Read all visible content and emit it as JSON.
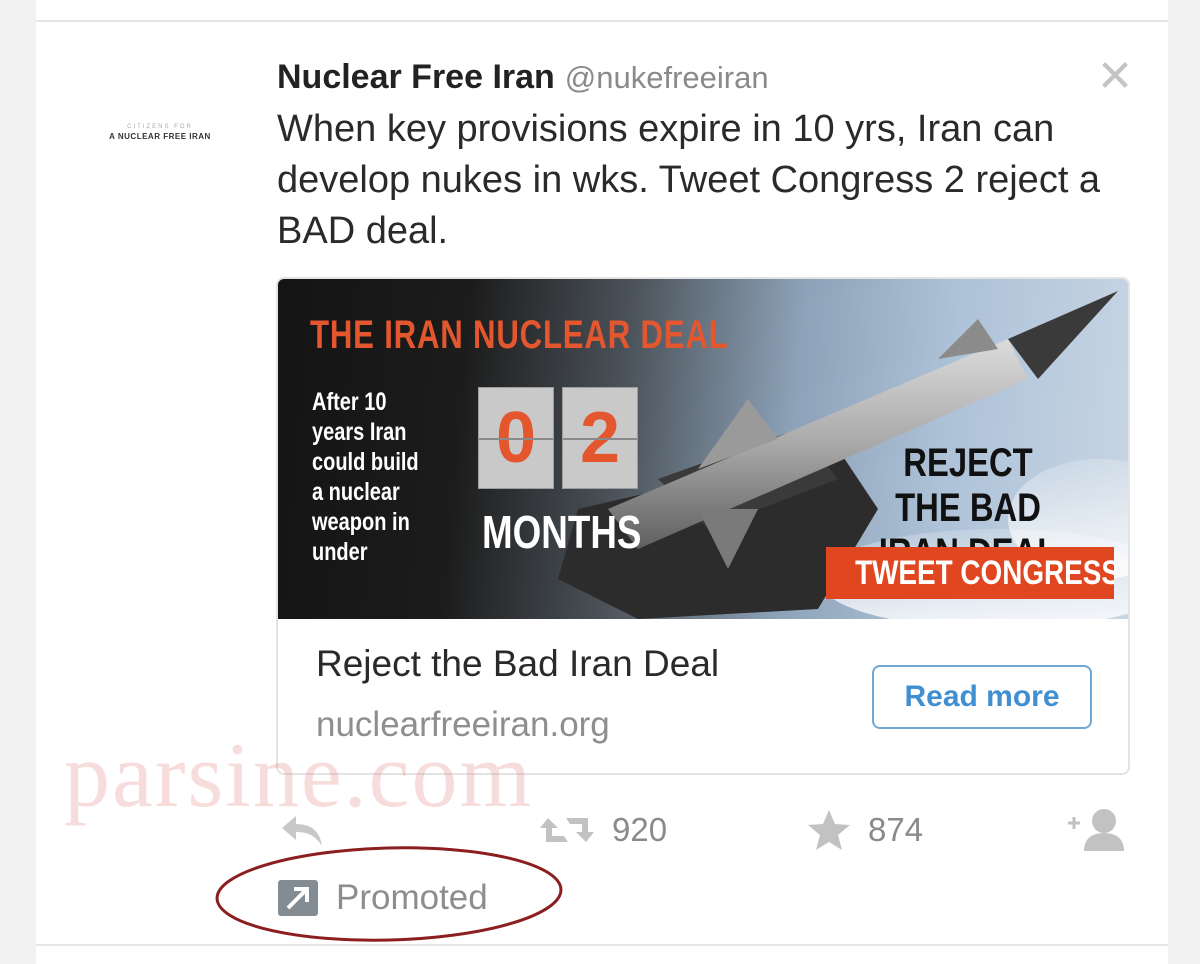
{
  "tweet": {
    "avatar": {
      "line1": "CITIZENS FOR",
      "line2": "A NUCLEAR FREE IRAN"
    },
    "author_name": "Nuclear Free Iran",
    "author_handle": "@nukefreeiran",
    "text": "When key provisions expire in 10 yrs, Iran can develop nukes in wks. Tweet Congress 2 reject a BAD deal.",
    "close_icon": "close-icon"
  },
  "card": {
    "image": {
      "heading": "THE IRAN NUCLEAR DEAL",
      "description": "After 10 years Iran could build a nuclear weapon in under",
      "digit_1": "0",
      "digit_2": "2",
      "unit": "MONTHS",
      "reject_text": "REJECT THE BAD IRAN DEAL",
      "cta": "TWEET CONGRESS"
    },
    "title": "Reject the Bad Iran Deal",
    "domain": "nuclearfreeiran.org",
    "read_more": "Read more"
  },
  "actions": {
    "reply_icon": "reply-icon",
    "retweet_icon": "retweet-icon",
    "retweet_count": "920",
    "favorite_icon": "star-icon",
    "favorite_count": "874",
    "follow_icon": "follow-icon"
  },
  "promoted": {
    "icon": "promoted-arrow-icon",
    "label": "Promoted"
  },
  "watermark": "parsine.com",
  "colors": {
    "accent_orange": "#e4572e",
    "link_blue": "#3f8fd1",
    "annotation_red": "#8b1f1f"
  }
}
